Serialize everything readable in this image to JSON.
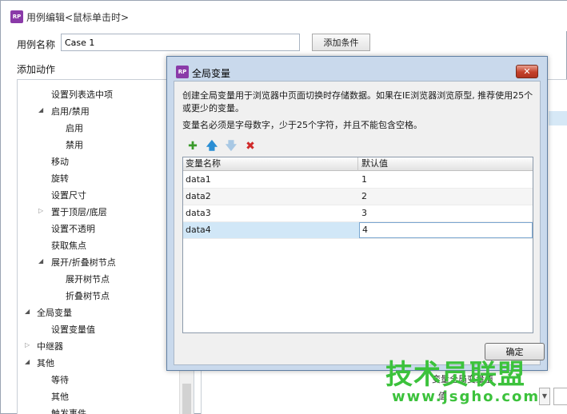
{
  "app": {
    "logo_text": "RP",
    "window_title": "用例编辑<鼠标单击时>"
  },
  "case": {
    "name_label": "用例名称",
    "name_value": "Case 1",
    "add_condition_label": "添加条件"
  },
  "actions": {
    "label": "添加动作",
    "tree": [
      {
        "label": "设置列表选中项",
        "level": 2,
        "arrow": ""
      },
      {
        "label": "启用/禁用",
        "level": 2,
        "arrow": "expanded"
      },
      {
        "label": "启用",
        "level": 3,
        "arrow": ""
      },
      {
        "label": "禁用",
        "level": 3,
        "arrow": ""
      },
      {
        "label": "移动",
        "level": 2,
        "arrow": ""
      },
      {
        "label": "旋转",
        "level": 2,
        "arrow": ""
      },
      {
        "label": "设置尺寸",
        "level": 2,
        "arrow": ""
      },
      {
        "label": "置于顶层/底层",
        "level": 2,
        "arrow": "collapsed"
      },
      {
        "label": "设置不透明",
        "level": 2,
        "arrow": ""
      },
      {
        "label": "获取焦点",
        "level": 2,
        "arrow": ""
      },
      {
        "label": "展开/折叠树节点",
        "level": 2,
        "arrow": "expanded"
      },
      {
        "label": "展开树节点",
        "level": 3,
        "arrow": ""
      },
      {
        "label": "折叠树节点",
        "level": 3,
        "arrow": ""
      },
      {
        "label": "全局变量",
        "level": 1,
        "arrow": "expanded"
      },
      {
        "label": "设置变量值",
        "level": 2,
        "arrow": ""
      },
      {
        "label": "中继器",
        "level": 1,
        "arrow": "collapsed"
      },
      {
        "label": "其他",
        "level": 1,
        "arrow": "expanded"
      },
      {
        "label": "等待",
        "level": 2,
        "arrow": ""
      },
      {
        "label": "其他",
        "level": 2,
        "arrow": ""
      },
      {
        "label": "触发事件",
        "level": 2,
        "arrow": ""
      }
    ]
  },
  "bottom_right": {
    "label1": "变量全局变量值",
    "label2": "值",
    "select_arrow": "▼"
  },
  "dialog": {
    "logo_text": "RP",
    "title": "全局变量",
    "close_glyph": "✕",
    "description_line1": "创建全局变量用于浏览器中页面切换时存储数据。如果在IE浏览器浏览原型, 推荐使用25个或更少的变量。",
    "description_line2": "变量名必须是字母数字，少于25个字符，并且不能包含空格。",
    "toolbar": {
      "add_glyph": "✚",
      "up_glyph": "🡅",
      "down_glyph": "🡇",
      "delete_glyph": "✖"
    },
    "table": {
      "col_name": "变量名称",
      "col_value": "默认值",
      "rows": [
        {
          "name": "data1",
          "value": "1"
        },
        {
          "name": "data2",
          "value": "2"
        },
        {
          "name": "data3",
          "value": "3"
        },
        {
          "name": "data4",
          "value": "4"
        }
      ]
    },
    "ok_label": "确定"
  },
  "watermark": {
    "main_text": "技术员联盟",
    "url_text": "www.jsgho.com"
  },
  "colors": {
    "dialog_bg": "#c9d9ec",
    "selected_row": "#d1e7f7",
    "close_button": "#c4402a",
    "logo": "#8a3aa8",
    "watermark": "#3cc23c"
  }
}
